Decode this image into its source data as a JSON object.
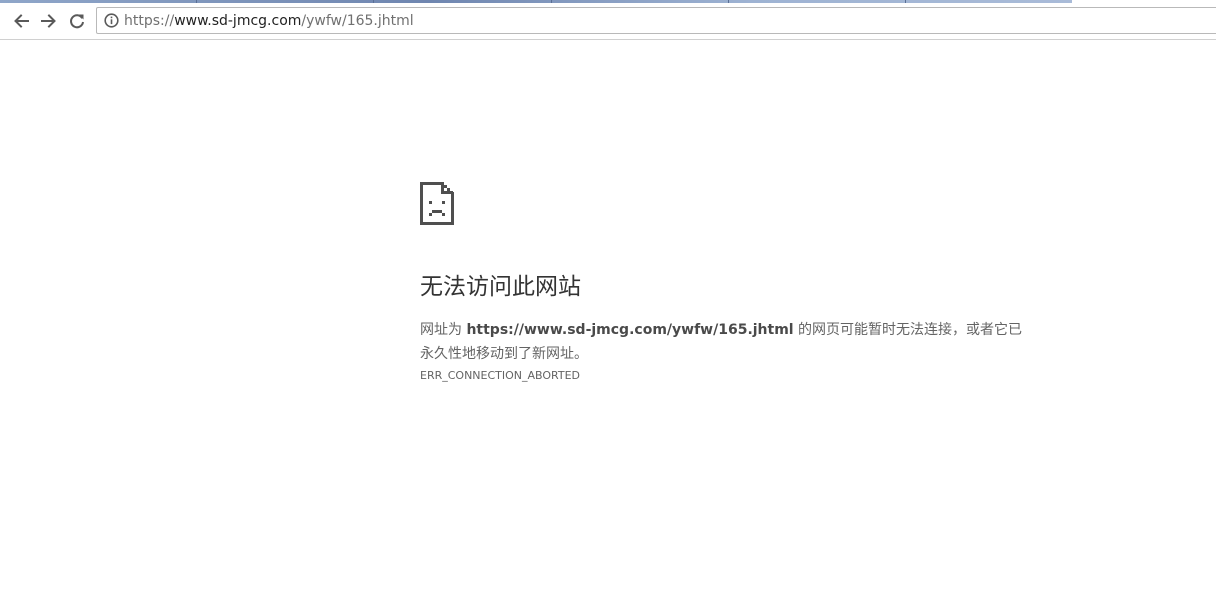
{
  "browser": {
    "address_bar": {
      "scheme": "https://",
      "host": "www.sd-jmcg.com",
      "path": "/ywfw/165.jhtml"
    },
    "icons": {
      "back": "arrow-left-icon",
      "forward": "arrow-right-icon",
      "reload": "reload-icon",
      "site_info": "info-circle-icon"
    }
  },
  "error": {
    "icon": "sad-page-icon",
    "title": "无法访问此网站",
    "desc_prefix": "网址为 ",
    "desc_url": "https://www.sd-jmcg.com/ywfw/165.jhtml",
    "desc_suffix": " 的网页可能暂时无法连接，或者它已永久性地移动到了新网址。",
    "code": "ERR_CONNECTION_ABORTED"
  },
  "colors": {
    "title": "#333333",
    "body_text": "#646464",
    "icon": "#4f4f4f"
  }
}
